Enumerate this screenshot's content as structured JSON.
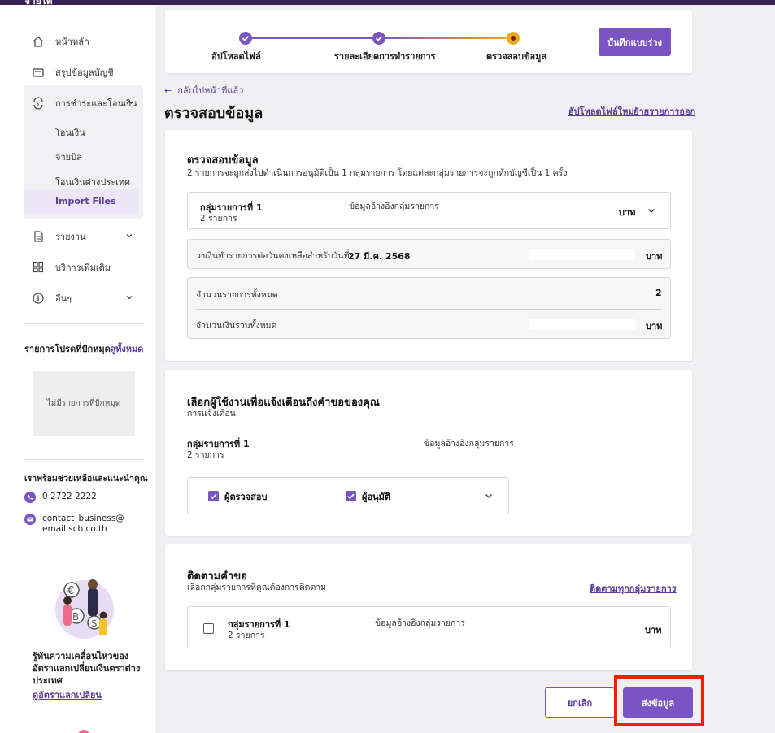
{
  "topbar": {
    "title": "จ่ายได้"
  },
  "sidebar": {
    "items": [
      {
        "label": "หน้าหลัก",
        "icon": "home-icon"
      },
      {
        "label": "สรุปข้อมูลบัญชี",
        "icon": "wallet-icon"
      },
      {
        "label": "การชำระและโอนเงิน",
        "icon": "transfer-icon"
      },
      {
        "label": "รายงาน",
        "icon": "report-icon"
      },
      {
        "label": "บริการเพิ่มเติม",
        "icon": "grid-icon"
      },
      {
        "label": "อื่นๆ",
        "icon": "info-icon"
      }
    ],
    "sub_items": [
      "โอนเงิน",
      "จ่ายบิล",
      "โอนเงินต่างประเทศ",
      "Import Files"
    ],
    "favorites": {
      "title": "รายการโปรดที่ปักหมุด",
      "link": "ดูทั้งหมด",
      "empty": "ไม่มีรายการที่ปักหมุด"
    },
    "help": {
      "title": "เราพร้อมช่วยเหลือและแนะนำคุณ",
      "phone": "0 2722 2222",
      "email_line1": "contact_business@",
      "email_line2": "email.scb.co.th"
    },
    "fx": {
      "text": "รู้ทันความเคลื่อนไหวของอัตราแลกเปลี่ยนเงินตราต่างประเทศ",
      "link": "ดูอัตราแลกเปลี่ยน"
    }
  },
  "stepper": {
    "steps": [
      "อัปโหลดไฟล์",
      "รายละเอียดการทำรายการ",
      "ตรวจสอบข้อมูล"
    ],
    "draft_label": "บันทึกแบบร่าง"
  },
  "header": {
    "back": "กลับไปหน้าที่แล้ว",
    "title": "ตรวจสอบข้อมูล",
    "upload_new": "อัปโหลดไฟล์ใหม่",
    "move_out": "ย้ายรายการออก"
  },
  "review": {
    "title": "ตรวจสอบข้อมูล",
    "subtitle": "2 รายการจะถูกส่งไปดำเนินการอนุมัติเป็น 1 กลุ่มรายการ โดยแต่ละกลุ่มรายการจะถูกหักบัญชีเป็น 1 ครั้ง",
    "group_name": "กลุ่มรายการที่ 1",
    "group_count": "2 รายการ",
    "group_ref": "ข้อมูลอ้างอิงกลุ่มรายการ",
    "group_amount_suffix": "บาท",
    "limit_label": "วงเงินทำรายการต่อวันคงเหลือสำหรับวันที่:",
    "limit_date": "27 มี.ค. 2568",
    "limit_suffix": "บาท",
    "total_items_label": "จำนวนรายการทั้งหมด",
    "total_items_value": "2",
    "total_amount_label": "จำนวนเงินรวมทั้งหมด",
    "total_amount_suffix": "บาท"
  },
  "notify": {
    "title": "เลือกผู้ใช้งานเพื่อแจ้งเตือนถึงคำขอของคุณ",
    "subtitle": "การแจ้งเตือน",
    "group_name": "กลุ่มรายการที่ 1",
    "group_count": "2 รายการ",
    "group_ref": "ข้อมูลอ้างอิงกลุ่มรายการ",
    "checker": "ผู้ตรวจสอบ",
    "approver": "ผู้อนุมัติ"
  },
  "track": {
    "title": "ติดตามคำขอ",
    "subtitle": "เลือกกลุ่มรายการที่คุณต้องการติดตาม",
    "track_all": "ติดตามทุกกลุ่มรายการ",
    "group_name": "กลุ่มรายการที่ 1",
    "group_count": "2 รายการ",
    "group_ref": "ข้อมูลอ้างอิงกลุ่มรายการ",
    "amount_suffix": "บาท"
  },
  "actions": {
    "cancel": "ยกเลิก",
    "submit": "ส่งข้อมูล"
  },
  "colors": {
    "accent": "#7a54c2",
    "step_done": "#7a54c2",
    "step_current": "#f0a818",
    "highlight": "#ff1a00"
  }
}
